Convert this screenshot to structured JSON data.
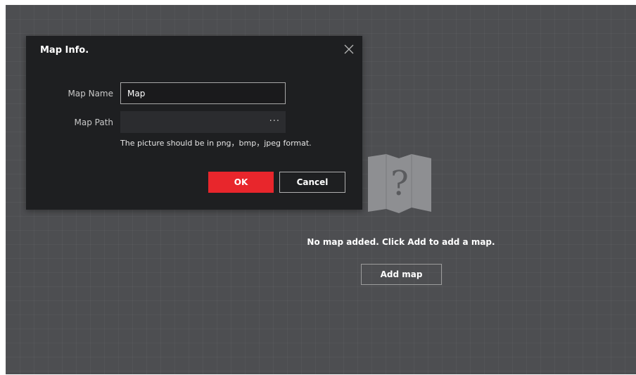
{
  "dialog": {
    "title": "Map Info.",
    "map_name_label": "Map Name",
    "map_name_value": "Map",
    "map_path_label": "Map Path",
    "map_path_value": "",
    "browse_label": "···",
    "hint": "The picture should be in png，bmp，jpeg format.",
    "ok_label": "OK",
    "cancel_label": "Cancel"
  },
  "empty_state": {
    "message": "No map added. Click Add to add a map.",
    "add_button_label": "Add map"
  },
  "icons": {
    "close": "close-icon",
    "empty_map": "map-question-icon"
  },
  "colors": {
    "background": "#4d4e51",
    "dialog": "#1e1f21",
    "accent": "#e8262c"
  }
}
